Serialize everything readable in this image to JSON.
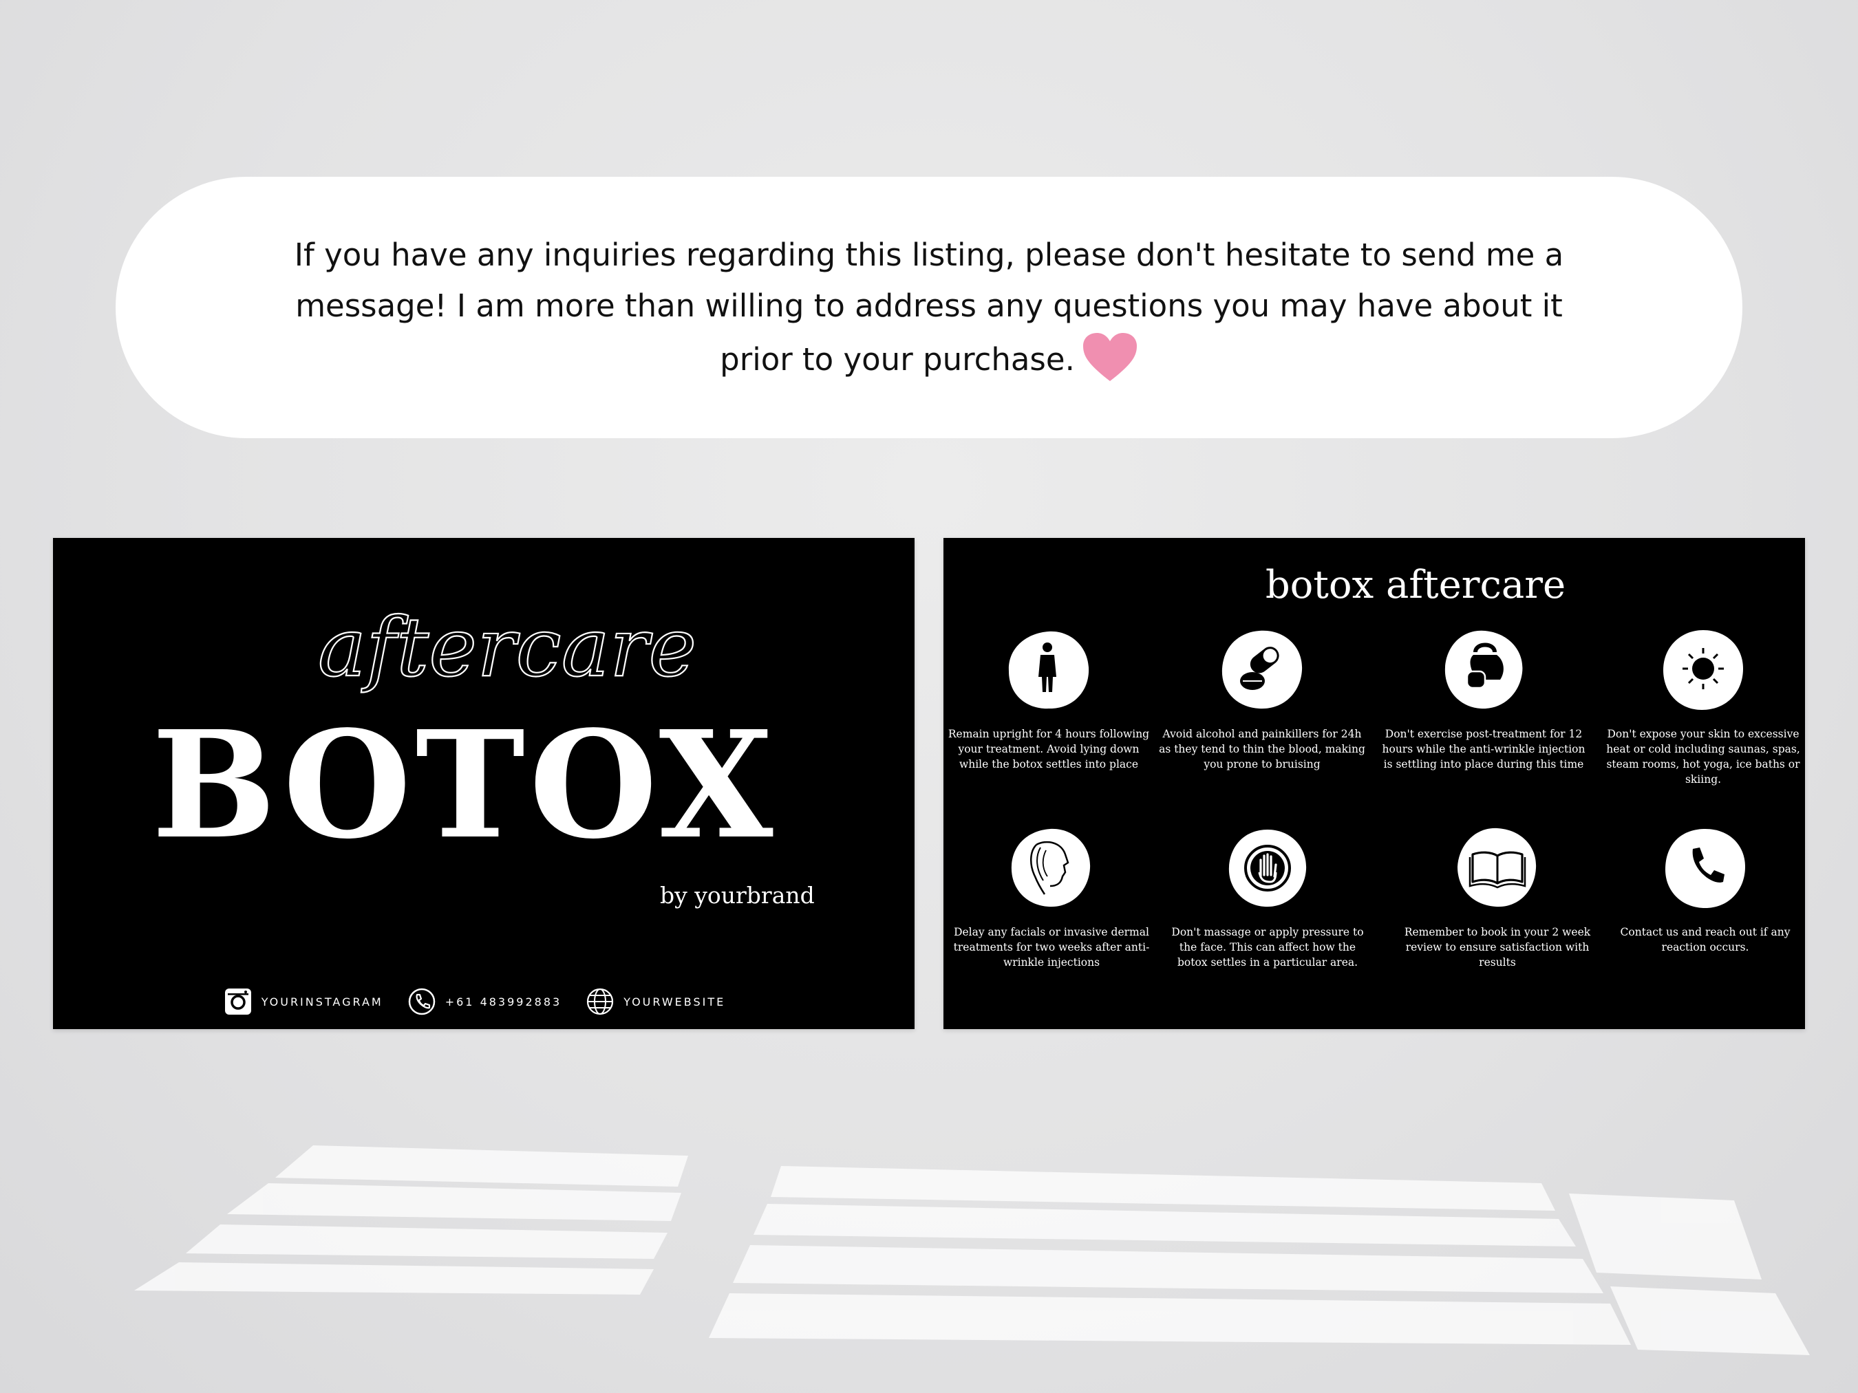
{
  "banner": {
    "message": "If you have any inquiries regarding this listing, please don't hesitate to send me a message! I am more than willing to address any questions you may have about it prior to your purchase."
  },
  "card_front": {
    "script_word": "aftercare",
    "title": "BOTOX",
    "byline": "by yourbrand",
    "contacts": [
      {
        "icon": "instagram-icon",
        "text": "YOURINSTAGRAM"
      },
      {
        "icon": "phone-icon",
        "text": "+61 483992883"
      },
      {
        "icon": "globe-icon",
        "text": "YOURWEBSITE"
      }
    ]
  },
  "card_back": {
    "title": "botox aftercare",
    "tips": [
      {
        "icon": "person-standing-icon",
        "text": "Remain upright for 4 hours following your treatment. Avoid lying down while the botox settles into place"
      },
      {
        "icon": "pills-icon",
        "text": "Avoid alcohol and painkillers for 24h as they tend to thin the blood, making you prone to bruising"
      },
      {
        "icon": "kettlebell-icon",
        "text": "Don't exercise post-treatment for 12 hours while the anti-wrinkle injection is settling into place during this time"
      },
      {
        "icon": "sun-icon",
        "text": "Don't expose your skin to excessive heat or cold including saunas, spas, steam rooms, hot yoga, ice baths or skiing."
      },
      {
        "icon": "face-profile-icon",
        "text": "Delay any facials or invasive dermal treatments for two weeks after anti-wrinkle injections"
      },
      {
        "icon": "stop-hand-icon",
        "text": "Don't massage or apply pressure to the face. This can affect how the botox settles in a particular area."
      },
      {
        "icon": "book-icon",
        "text": "Remember to book in your 2 week review to ensure satisfaction with results"
      },
      {
        "icon": "phone-icon",
        "text": "Contact us and reach out if any reaction occurs."
      }
    ]
  },
  "colors": {
    "background": "#e4e4e5",
    "card": "#000000",
    "banner": "#ffffff",
    "heart": "#f08fb0"
  }
}
